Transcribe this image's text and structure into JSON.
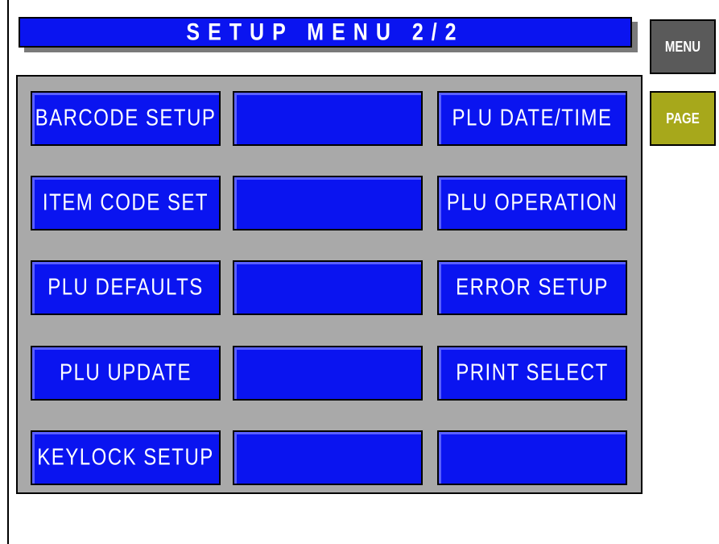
{
  "title": "SETUP MENU 2/2",
  "side_buttons": {
    "menu_label": "MENU",
    "page_label": "PAGE"
  },
  "grid": {
    "col1": [
      "BARCODE SETUP",
      "ITEM CODE SET",
      "PLU DEFAULTS",
      "PLU UPDATE",
      "KEYLOCK SETUP"
    ],
    "col2": [
      "",
      "",
      "",
      "",
      ""
    ],
    "col3": [
      "PLU DATE/TIME",
      "PLU OPERATION",
      "ERROR SETUP",
      "PRINT SELECT",
      ""
    ]
  },
  "colors": {
    "button_blue": "#0a14f0",
    "panel_gray": "#a9a9a9",
    "menu_gray": "#5a5a5a",
    "page_olive": "#a7a81b"
  }
}
